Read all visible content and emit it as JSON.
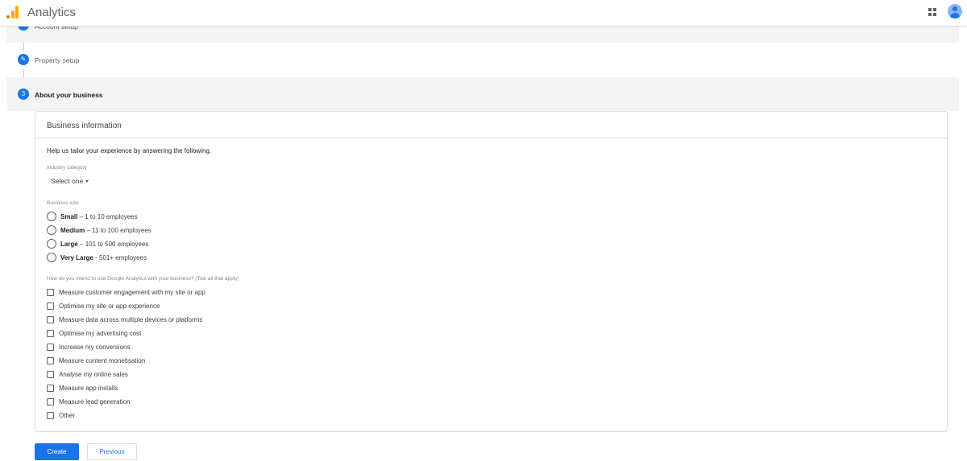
{
  "header": {
    "app_title": "Analytics",
    "apps_icon": "apps-grid-icon",
    "avatar_icon": "account-avatar-icon"
  },
  "steps": [
    {
      "number": "✓",
      "label": "Account setup",
      "state": "completed",
      "icon": "edit-pencil-icon"
    },
    {
      "number": "✎",
      "label": "Property setup",
      "state": "completed",
      "icon": "edit-pencil-icon"
    },
    {
      "number": "3",
      "label": "About your business",
      "state": "active"
    }
  ],
  "card": {
    "title": "Business information",
    "intro": "Help us tailor your experience by answering the following.",
    "industry": {
      "label": "Industry category",
      "value": "Select one"
    },
    "business_size": {
      "label": "Business size",
      "options": [
        {
          "bold": "Small",
          "rest": " – 1 to 10 employees",
          "selected": false
        },
        {
          "bold": "Medium",
          "rest": " – 11 to 100 employees",
          "selected": false
        },
        {
          "bold": "Large",
          "rest": " – 101 to 500 employees",
          "selected": false
        },
        {
          "bold": "Very Large",
          "rest": " - 501+ employees",
          "selected": false
        }
      ]
    },
    "usage": {
      "label": "How do you intend to use Google Analytics with your business? (Tick all that apply)",
      "options": [
        "Measure customer engagement with my site or app",
        "Optimise my site or app experience",
        "Measure data across multiple devices or platforms",
        "Optimise my advertising cost",
        "Increase my conversions",
        "Measure content monetisation",
        "Analyse my online sales",
        "Measure app installs",
        "Measure lead generation",
        "Other"
      ]
    }
  },
  "buttons": {
    "create": "Create",
    "previous": "Previous"
  },
  "colors": {
    "accent": "#1a73e8",
    "logo_orange": "#f9ab00",
    "logo_dark_orange": "#e37400"
  }
}
